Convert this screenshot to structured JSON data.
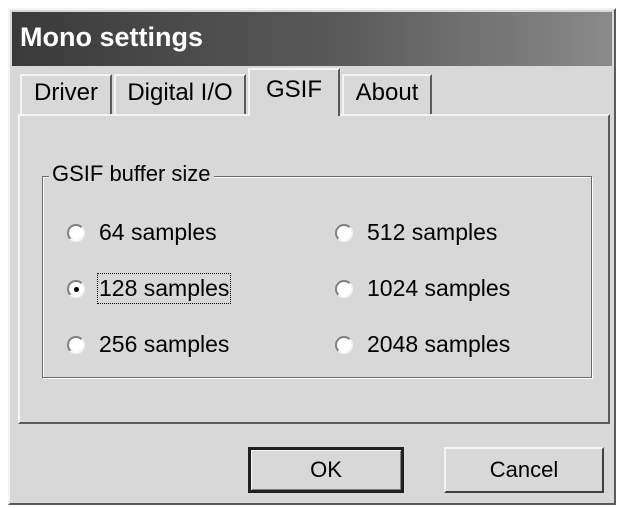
{
  "window": {
    "title": "Mono settings"
  },
  "tabs": [
    {
      "label": "Driver"
    },
    {
      "label": "Digital I/O"
    },
    {
      "label": "GSIF",
      "active": true
    },
    {
      "label": "About"
    }
  ],
  "group": {
    "legend": "GSIF buffer size",
    "options": [
      {
        "label": "64 samples",
        "checked": false
      },
      {
        "label": "128 samples",
        "checked": true
      },
      {
        "label": "256 samples",
        "checked": false
      },
      {
        "label": "512 samples",
        "checked": false
      },
      {
        "label": "1024 samples",
        "checked": false
      },
      {
        "label": "2048 samples",
        "checked": false
      }
    ]
  },
  "buttons": {
    "ok": "OK",
    "cancel": "Cancel"
  }
}
